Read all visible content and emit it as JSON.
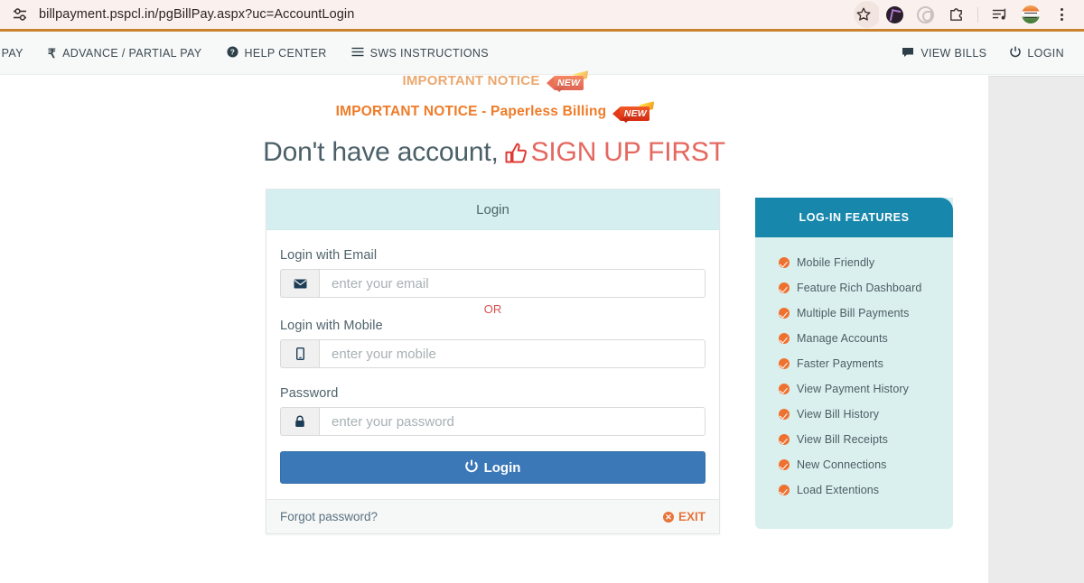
{
  "browser": {
    "url": "billpayment.pspcl.in/pgBillPay.aspx?uc=AccountLogin",
    "tune_icon": "tune-icon",
    "star_icon": "bookmark-star-icon",
    "extension_icons": [
      "extension-avatar-icon",
      "extension-circle-icon",
      "extensions-puzzle-icon"
    ],
    "split_icon": "split-view-icon",
    "profile_icon": "profile-avatar-icon",
    "menu_icon": "kebab-menu-icon",
    "accent_underline": "#c9832e"
  },
  "nav": {
    "left_items": [
      {
        "icon": "partial-pay-icon",
        "label": "PAY"
      },
      {
        "icon": "rupee-icon",
        "label": "ADVANCE / PARTIAL PAY"
      },
      {
        "icon": "help-circle-icon",
        "label": "HELP CENTER"
      },
      {
        "icon": "hamburger-icon",
        "label": "SWS INSTRUCTIONS"
      }
    ],
    "right_items": [
      {
        "icon": "comment-icon",
        "label": "VIEW BILLS"
      },
      {
        "icon": "power-icon",
        "label": "LOGIN"
      }
    ]
  },
  "notices": [
    {
      "text": "IMPORTANT NOTICE",
      "badge": "NEW"
    },
    {
      "text": "IMPORTANT NOTICE - Paperless Billing",
      "badge": "NEW"
    }
  ],
  "signup": {
    "lead": "Don't have account,",
    "link": "SIGN UP FIRST",
    "icon": "thumbs-up-icon",
    "link_color": "#e4685f"
  },
  "login": {
    "title": "Login",
    "email_label": "Login with Email",
    "email_placeholder": "enter your email",
    "email_value": "",
    "email_icon": "envelope-icon",
    "or_text": "OR",
    "mobile_label": "Login with Mobile",
    "mobile_placeholder": "enter your mobile",
    "mobile_value": "",
    "mobile_icon": "mobile-phone-icon",
    "password_label": "Password",
    "password_placeholder": "enter your password",
    "password_value": "",
    "password_icon": "lock-icon",
    "submit_label": "Login",
    "submit_icon": "power-icon",
    "submit_color": "#3b78b8",
    "forgot_label": "Forgot password?",
    "exit_label": "EXIT",
    "exit_icon": "close-circle-icon",
    "exit_color": "#e8743a",
    "header_bg": "#d5eff0"
  },
  "features": {
    "title": "LOG-IN FEATURES",
    "header_bg": "#1887ac",
    "panel_bg": "#d9f0ee",
    "bullet_color": "#ef7130",
    "items": [
      "Mobile Friendly",
      "Feature Rich Dashboard",
      "Multiple Bill Payments",
      "Manage Accounts",
      "Faster Payments",
      "View Payment History",
      "View Bill History",
      "View Bill Receipts",
      "New Connections",
      "Load Extentions"
    ]
  }
}
